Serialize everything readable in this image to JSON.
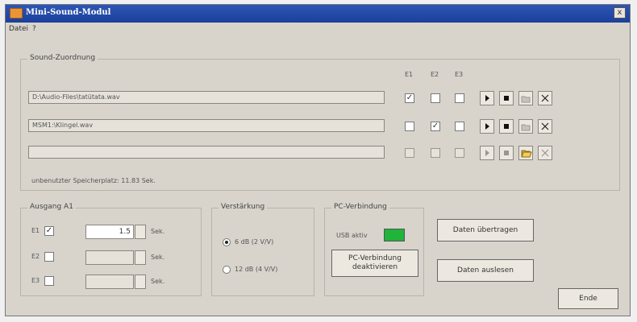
{
  "window": {
    "title": "Mini-Sound-Modul",
    "close_label": "x"
  },
  "menu": [
    "Datei",
    "?"
  ],
  "sound_group": {
    "label": "Sound-Zuordnung",
    "columns": [
      "E1",
      "E2",
      "E3"
    ],
    "rows": [
      {
        "file": "D:\\Audio-Files\\tatütata.wav",
        "checks": [
          true,
          false,
          false
        ],
        "disabled": false
      },
      {
        "file": "MSM1:\\Klingel.wav",
        "checks": [
          false,
          true,
          false
        ],
        "disabled": false
      },
      {
        "file": "",
        "checks": [
          false,
          false,
          false
        ],
        "disabled": true
      }
    ],
    "free_space": "unbenutzter Speicherplatz: 11.83 Sek."
  },
  "ausgang": {
    "label": "Ausgang A1",
    "rows": [
      {
        "label": "E1",
        "checked": true,
        "value": "1.5",
        "unit": "Sek."
      },
      {
        "label": "E2",
        "checked": false,
        "value": "",
        "unit": "Sek."
      },
      {
        "label": "E3",
        "checked": false,
        "value": "",
        "unit": "Sek."
      }
    ]
  },
  "verstaerkung": {
    "label": "Verstärkung",
    "options": [
      {
        "label": "6 dB (2 V/V)",
        "selected": true
      },
      {
        "label": "12 dB (4 V/V)",
        "selected": false
      }
    ]
  },
  "pc": {
    "label": "PC-Verbindung",
    "usb_label": "USB aktiv",
    "usb_color": "#1fb43a",
    "button_line1": "PC-Verbindung",
    "button_line2": "deaktivieren"
  },
  "buttons": {
    "send": "Daten übertragen",
    "read": "Daten auslesen",
    "end": "Ende"
  }
}
